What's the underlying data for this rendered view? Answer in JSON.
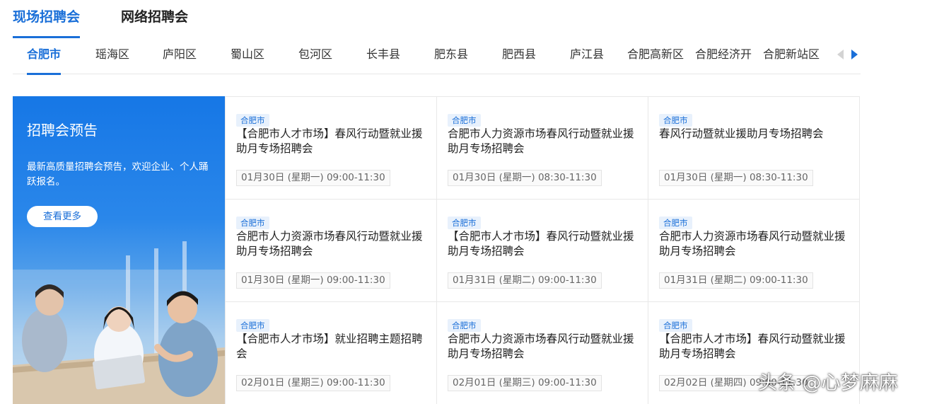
{
  "main_tabs": [
    {
      "label": "现场招聘会",
      "active": true
    },
    {
      "label": "网络招聘会",
      "active": false
    }
  ],
  "districts": [
    {
      "label": "合肥市",
      "active": true
    },
    {
      "label": "瑶海区"
    },
    {
      "label": "庐阳区"
    },
    {
      "label": "蜀山区"
    },
    {
      "label": "包河区"
    },
    {
      "label": "长丰县"
    },
    {
      "label": "肥东县"
    },
    {
      "label": "肥西县"
    },
    {
      "label": "庐江县"
    },
    {
      "label": "合肥高新区"
    },
    {
      "label": "合肥经济开"
    },
    {
      "label": "合肥新站区"
    }
  ],
  "promo": {
    "title": "招聘会预告",
    "desc": "最新高质量招聘会预告，欢迎企业、个人踊跃报名。",
    "button": "查看更多"
  },
  "fairs": [
    {
      "tag": "合肥市",
      "title": "【合肥市人才市场】春风行动暨就业援助月专场招聘会",
      "time": "01月30日 (星期一) 09:00-11:30"
    },
    {
      "tag": "合肥市",
      "title": "合肥市人力资源市场春风行动暨就业援助月专场招聘会",
      "time": "01月30日 (星期一) 08:30-11:30"
    },
    {
      "tag": "合肥市",
      "title": "春风行动暨就业援助月专场招聘会",
      "time": "01月30日 (星期一) 08:30-11:30"
    },
    {
      "tag": "合肥市",
      "title": "合肥市人力资源市场春风行动暨就业援助月专场招聘会",
      "time": "01月30日 (星期一) 09:00-11:30"
    },
    {
      "tag": "合肥市",
      "title": "【合肥市人才市场】春风行动暨就业援助月专场招聘会",
      "time": "01月31日 (星期二) 09:00-11:30"
    },
    {
      "tag": "合肥市",
      "title": "合肥市人力资源市场春风行动暨就业援助月专场招聘会",
      "time": "01月31日 (星期二) 09:00-11:30"
    },
    {
      "tag": "合肥市",
      "title": "【合肥市人才市场】就业招聘主题招聘会",
      "time": "02月01日 (星期三) 09:00-11:30"
    },
    {
      "tag": "合肥市",
      "title": "合肥市人力资源市场春风行动暨就业援助月专场招聘会",
      "time": "02月01日 (星期三) 09:00-11:30"
    },
    {
      "tag": "合肥市",
      "title": "【合肥市人才市场】春风行动暨就业援助月专场招聘会",
      "time": "02月02日 (星期四) 09:00-11:30"
    }
  ],
  "watermark": "头条 @心梦麻麻",
  "colors": {
    "accent": "#1a6fd8",
    "promo_bg": "#1677e6"
  },
  "icons": {
    "prev": "chevron-left-icon",
    "next": "chevron-right-icon"
  }
}
